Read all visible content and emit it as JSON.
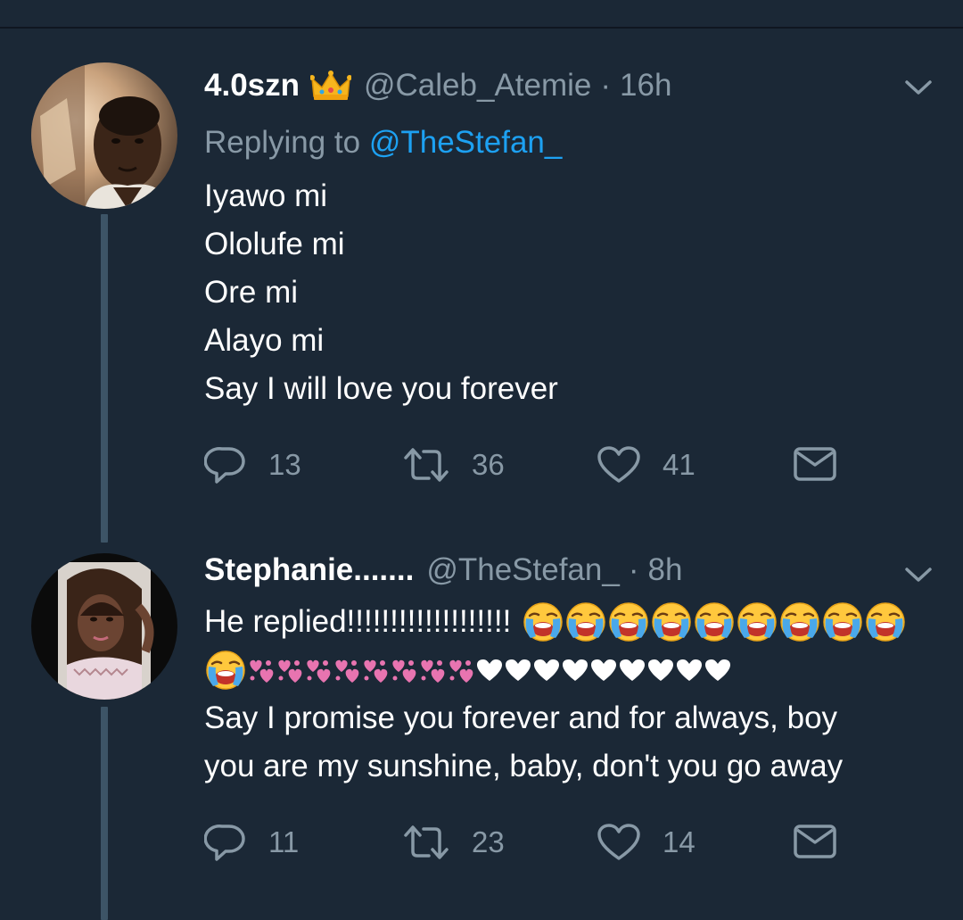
{
  "tweets": [
    {
      "display_name": "4.0szn",
      "badge_emoji": "crown",
      "handle": "@Caleb_Atemie",
      "separator": "·",
      "time": "16h",
      "replying_prefix": "Replying to",
      "replying_to": "@TheStefan_",
      "lines": [
        "Iyawo mi",
        "Ololufe mi",
        "Ore mi",
        "Alayo mi",
        "Say I will love you forever"
      ],
      "reply_count": "13",
      "retweet_count": "36",
      "like_count": "41"
    },
    {
      "display_name": "Stephanie.......",
      "handle": "@TheStefan_",
      "separator": "·",
      "time": "8h",
      "text_prefix": "He replied!!!!!!!!!!!!!!!!!!!",
      "emoji_line1": [
        "loudly-crying-face",
        "loudly-crying-face",
        "loudly-crying-face",
        "loudly-crying-face",
        "loudly-crying-face",
        "loudly-crying-face",
        "loudly-crying-face",
        "loudly-crying-face",
        "loudly-crying-face"
      ],
      "emoji_line2_faces": [
        "loudly-crying-face"
      ],
      "emoji_line2_hearts": [
        "two-hearts",
        "two-hearts",
        "two-hearts",
        "two-hearts",
        "two-hearts",
        "two-hearts",
        "two-hearts",
        "two-hearts"
      ],
      "emoji_line2_white_hearts": [
        "white-heart",
        "white-heart",
        "white-heart",
        "white-heart",
        "white-heart",
        "white-heart",
        "white-heart",
        "white-heart",
        "white-heart"
      ],
      "lines": [
        "Say I promise you forever and for always, boy",
        "you are my sunshine, baby, don't you go away"
      ],
      "reply_count": "11",
      "retweet_count": "23",
      "like_count": "14"
    }
  ],
  "colors": {
    "background": "#1b2836",
    "secondary_text": "#8899a6",
    "link": "#1da1f2",
    "thread_line": "#3d5466"
  },
  "icons": [
    "reply-icon",
    "retweet-icon",
    "like-icon",
    "direct-message-icon",
    "chevron-down-icon"
  ]
}
